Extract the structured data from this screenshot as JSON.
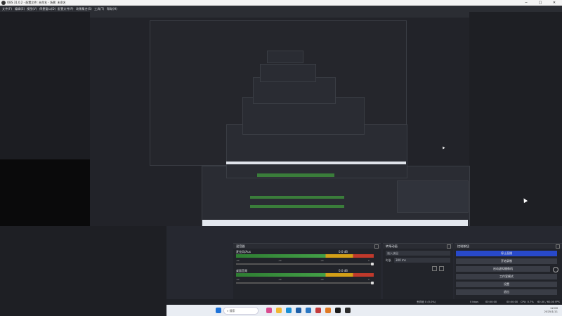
{
  "window": {
    "title": "OBS 31.0.2 - 配置文件: 未命名 - 场景: 未命名",
    "controls": {
      "minimize": "─",
      "maximize": "□",
      "close": "✕"
    }
  },
  "menu": [
    "文件(F)",
    "编辑(E)",
    "视图(V)",
    "停靠窗口(D)",
    "配置文件(P)",
    "场景集合(S)",
    "工具(T)",
    "帮助(H)"
  ],
  "docks": {
    "audio_mixer": {
      "title": "混音器",
      "channels": [
        {
          "name": "麦克风/Aux",
          "level": "0.0 dB"
        },
        {
          "name": "桌面音频",
          "level": "0.0 dB"
        }
      ],
      "ticks": [
        "-60",
        "-55",
        "-50",
        "-45",
        "-40",
        "-35",
        "-30",
        "-25",
        "-20",
        "-15",
        "-10",
        "-5",
        "0"
      ]
    },
    "transitions": {
      "title": "转场动画",
      "transition": "淡入淡出",
      "duration_label": "时长",
      "duration_value": "300 ms"
    },
    "controls": {
      "title": "控制按钮",
      "buttons": [
        "停止直播",
        "开始录制",
        "启动虚拟摄像机",
        "工作室模式",
        "设置",
        "退出"
      ]
    }
  },
  "statusbar": {
    "frames": "丢弃帧 0 (0.0%)",
    "bitrate": "0 kbps",
    "live_time": "00:00:00",
    "rec_time": "00:00:00",
    "cpu": "CPU: 0.7%",
    "fps": "60.00 / 60.00 FPS"
  },
  "taskbar": {
    "search_placeholder": "搜索",
    "time": "12:00",
    "date": "2025/1/11"
  },
  "colors": {
    "accent": "#2849c9",
    "meter_green": "#43a047",
    "meter_yellow": "#d4a017",
    "meter_red": "#c0392b"
  }
}
